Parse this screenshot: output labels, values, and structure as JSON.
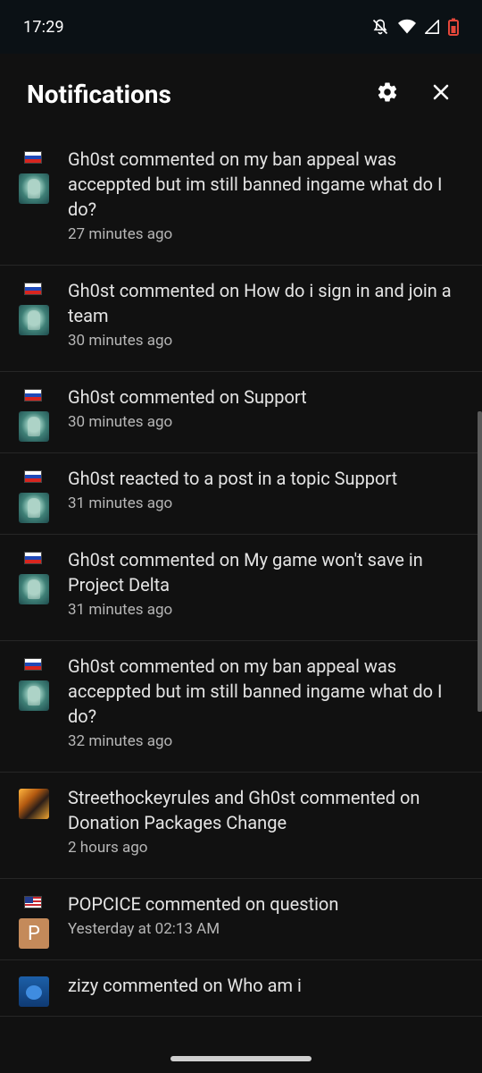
{
  "status_bar": {
    "time": "17:29",
    "icons": [
      "bell-off-icon",
      "wifi-icon",
      "signal-icon",
      "battery-icon"
    ]
  },
  "header": {
    "title": "Notifications",
    "settings_icon": "gear-icon",
    "close_icon": "close-icon"
  },
  "notifications": [
    {
      "flag": "russia-flag",
      "avatar": "ghost-avatar",
      "text": "Gh0st commented on my ban appeal was acceppted but im still banned ingame what do I do?",
      "time": "27 minutes ago"
    },
    {
      "flag": "russia-flag",
      "avatar": "ghost-avatar",
      "text": "Gh0st commented on How do i sign in and join a team",
      "time": "30 minutes ago"
    },
    {
      "flag": "russia-flag",
      "avatar": "ghost-avatar",
      "text": "Gh0st commented on Support",
      "time": "30 minutes ago"
    },
    {
      "flag": "russia-flag",
      "avatar": "ghost-avatar",
      "text": "Gh0st reacted to a post in a topic Support",
      "time": "31 minutes ago"
    },
    {
      "flag": "russia-flag",
      "avatar": "ghost-avatar",
      "text": "Gh0st commented on My game won't save in Project Delta",
      "time": "31 minutes ago"
    },
    {
      "flag": "russia-flag",
      "avatar": "ghost-avatar",
      "text": "Gh0st commented on my ban appeal was acceppted but im still banned ingame what do I do?",
      "time": "32 minutes ago"
    },
    {
      "avatar": "streethockey-avatar",
      "text": "Streethockeyrules and Gh0st commented on Donation Packages Change",
      "time": "2 hours ago"
    },
    {
      "flag": "usa-flag",
      "avatar_letter": "P",
      "text": "POPCICE commented on question",
      "time": "Yesterday at 02:13 AM"
    },
    {
      "avatar": "zizy-avatar",
      "text": "zizy commented on Who am i",
      "time": ""
    }
  ],
  "colors": {
    "background": "#111111",
    "status_bar": "#0b1115",
    "divider": "#262626",
    "text": "#e4e4e4",
    "secondary_text": "#b6b6b6",
    "avatar_letter_bg": "#c48a5a"
  }
}
